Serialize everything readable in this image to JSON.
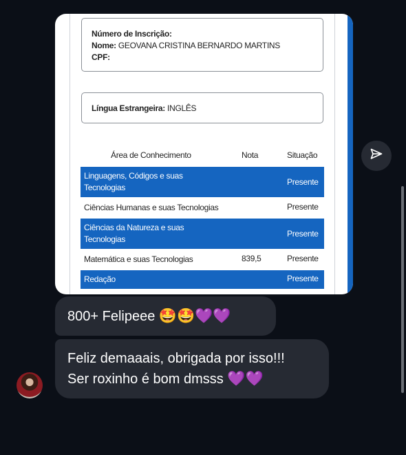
{
  "card": {
    "inscricao_label": "Número de Inscrição:",
    "nome_label": "Nome:",
    "nome_value": "GEOVANA CRISTINA BERNARDO MARTINS",
    "cpf_label": "CPF:",
    "lingua_label": "Língua Estrangeira:",
    "lingua_value": "INGLÊS",
    "table": {
      "headers": {
        "area": "Área de Conhecimento",
        "nota": "Nota",
        "situacao": "Situação"
      },
      "rows": [
        {
          "area": "Linguagens, Códigos e suas Tecnologias",
          "nota": "",
          "situacao": "Presente"
        },
        {
          "area": "Ciências Humanas e suas Tecnologias",
          "nota": "",
          "situacao": "Presente"
        },
        {
          "area": "Ciências da Natureza e suas Tecnologias",
          "nota": "",
          "situacao": "Presente"
        },
        {
          "area": "Matemática e suas Tecnologias",
          "nota": "839,5",
          "situacao": "Presente"
        },
        {
          "area": "Redação",
          "nota": "",
          "situacao": "Presente"
        }
      ]
    },
    "accent_color": "#1565c0"
  },
  "messages": [
    {
      "text": "800+ Felipeee",
      "emojis": "🤩🤩💜💜"
    },
    {
      "line1": "Feliz demaaais, obrigada por isso!!!",
      "line2": "Ser roxinho é bom dmsss",
      "emojis": "💜💜"
    }
  ],
  "icons": {
    "share": "paper-plane-icon",
    "avatar": "user-avatar"
  }
}
